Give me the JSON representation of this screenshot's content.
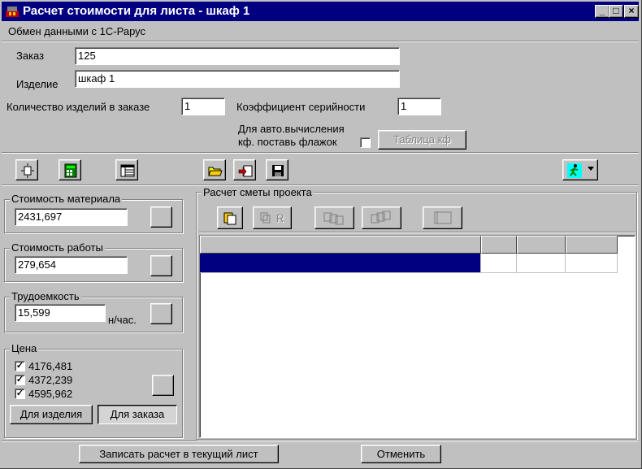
{
  "window": {
    "title": "Расчет стоимости для листа - шкаф 1",
    "controls": [
      "_",
      "□",
      "×"
    ]
  },
  "menu": {
    "item_1c": "Обмен данными с 1С-Рарус"
  },
  "order": {
    "order_label": "Заказ",
    "order_value": "125",
    "product_label": "Изделие",
    "product_value": "шкаф 1",
    "quantity_label": "Количество изделий в заказе",
    "quantity_value": "1",
    "serial_label": "Коэффициент серийности",
    "serial_value": "1",
    "auto_calc_line1": "Для авто.вычисления",
    "auto_calc_line2": "кф. поставь флажок",
    "coef_table_button": "Таблица кф"
  },
  "toolbar": {
    "icons": [
      "settings-icon",
      "calculator-icon",
      "table-icon",
      "open-folder-icon",
      "export-icon",
      "save-icon",
      "run-icon"
    ]
  },
  "left": {
    "material_title": "Стоимость материала",
    "material_value": "2431,697",
    "work_title": "Стоимость работы",
    "work_value": "279,654",
    "labor_title": "Трудоемкость",
    "labor_value": "15,599",
    "labor_unit": "н/час.",
    "price_title": "Цена",
    "prices": [
      {
        "value": "4176,481",
        "checked": true
      },
      {
        "value": "4372,239",
        "checked": true
      },
      {
        "value": "4595,962",
        "checked": true
      }
    ],
    "for_product_button": "Для изделия",
    "for_order_button": "Для заказа"
  },
  "estimate": {
    "title": "Расчет сметы проекта",
    "copy_r_label": "R"
  },
  "footer": {
    "write_button": "Записать расчет в текущий лист",
    "cancel_button": "Отменить"
  },
  "colors": {
    "titlebar": "#000080",
    "face": "#c0c0c0",
    "selection": "#000080"
  }
}
